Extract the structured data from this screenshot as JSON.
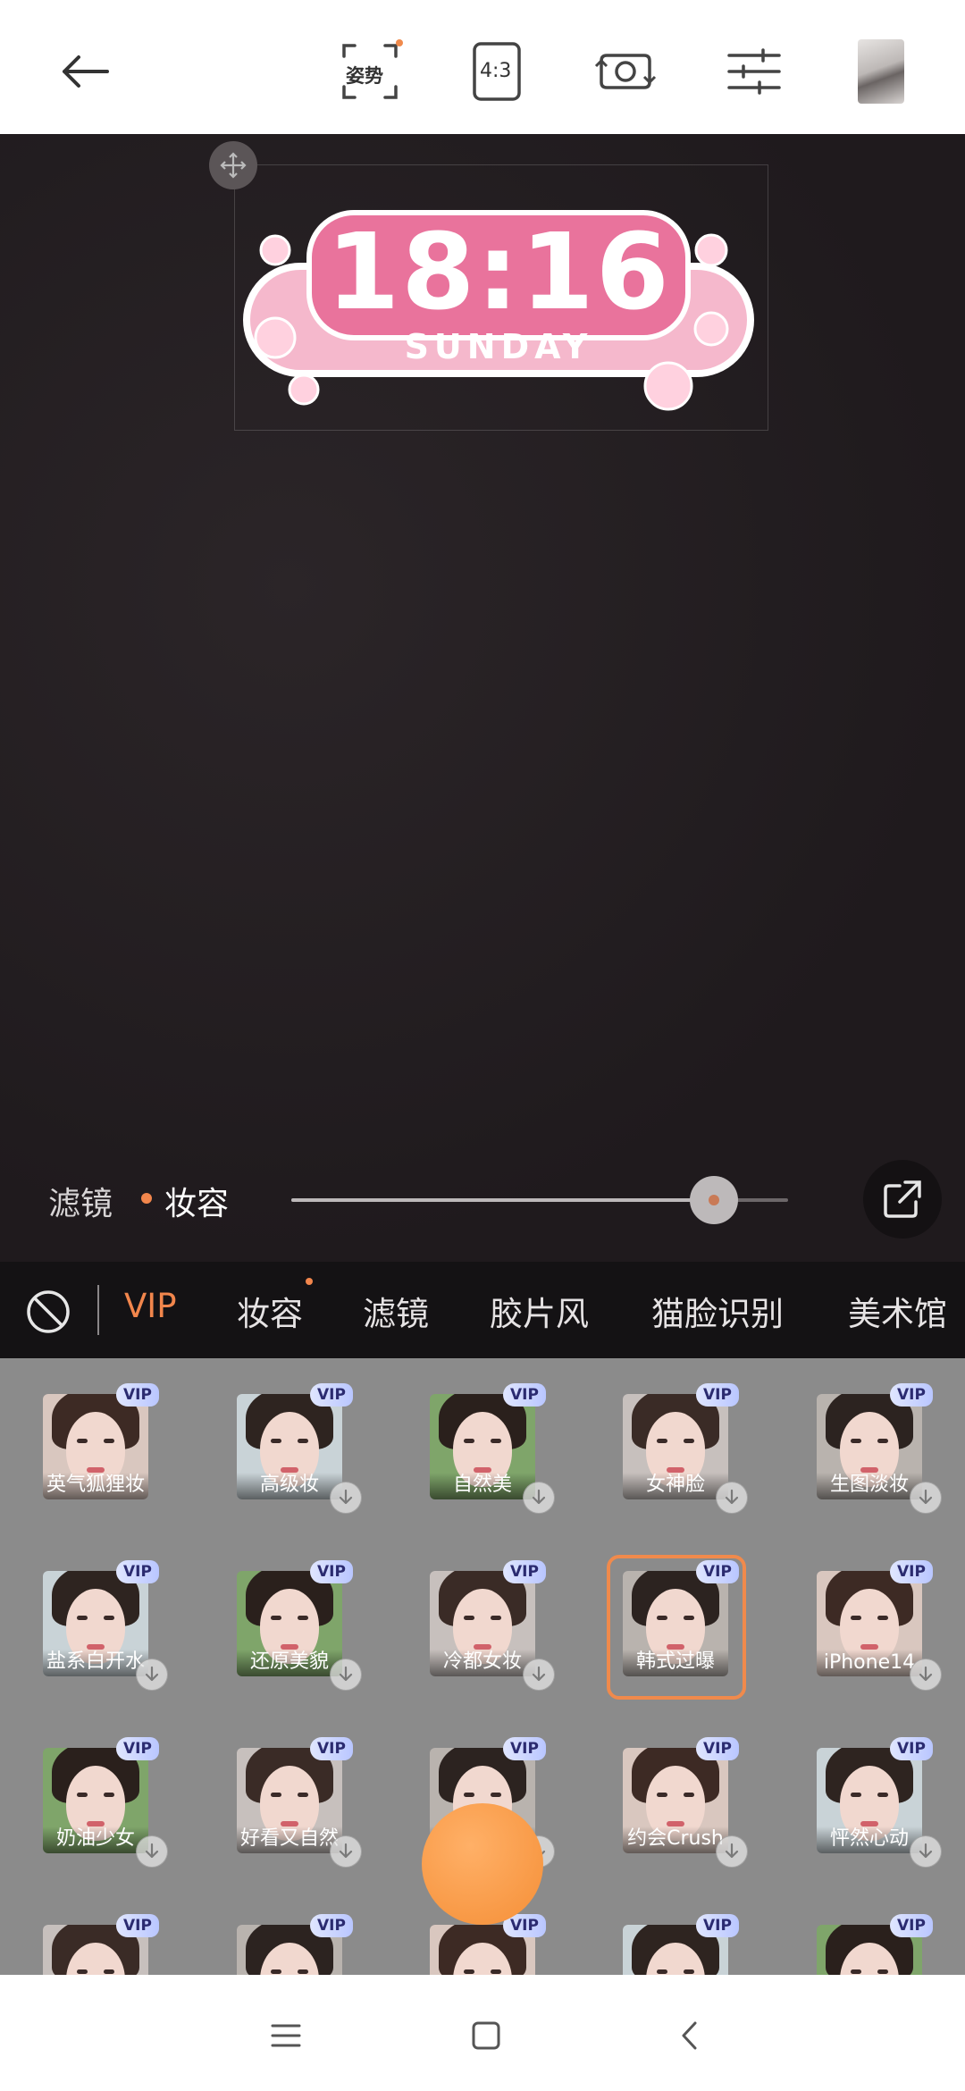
{
  "toolbar": {
    "back_icon": "back-arrow-icon",
    "pose_label": "姿势",
    "ratio_label": "4:3",
    "flip_icon": "switch-camera-icon",
    "settings_icon": "sliders-icon"
  },
  "sticker": {
    "time": "18:16",
    "day": "SUNDAY"
  },
  "slider": {
    "left_label": "滤镜",
    "right_label": "妆容",
    "value": 0.85
  },
  "tabs": [
    {
      "label": "VIP",
      "active": true
    },
    {
      "label": "妆容",
      "active": false,
      "dot": true
    },
    {
      "label": "滤镜",
      "active": false
    },
    {
      "label": "胶片风",
      "active": false
    },
    {
      "label": "猫脸识别",
      "active": false
    },
    {
      "label": "美术馆",
      "active": false
    }
  ],
  "vip_badge": "VIP",
  "grid": {
    "rows": [
      [
        {
          "name": "英气狐狸妆",
          "download": false
        },
        {
          "name": "高级妆",
          "download": true
        },
        {
          "name": "自然美",
          "download": true
        },
        {
          "name": "女神脸",
          "download": true
        },
        {
          "name": "生图淡妆",
          "download": true
        }
      ],
      [
        {
          "name": "盐系白开水",
          "download": true
        },
        {
          "name": "还原美貌",
          "download": true
        },
        {
          "name": "冷都女妆",
          "download": true
        },
        {
          "name": "韩式过曝",
          "download": false,
          "selected": true
        },
        {
          "name": "iPhone14",
          "download": true
        }
      ],
      [
        {
          "name": "奶油少女",
          "download": true
        },
        {
          "name": "好看又自然",
          "download": true
        },
        {
          "name": "",
          "download": true
        },
        {
          "name": "约会Crush",
          "download": true
        },
        {
          "name": "怦然心动",
          "download": true
        }
      ],
      [
        {
          "name": ""
        },
        {
          "name": ""
        },
        {
          "name": ""
        },
        {
          "name": ""
        },
        {
          "name": ""
        }
      ]
    ]
  },
  "colors": {
    "accent": "#f2864c",
    "sticker_pink": "#e9739c"
  }
}
